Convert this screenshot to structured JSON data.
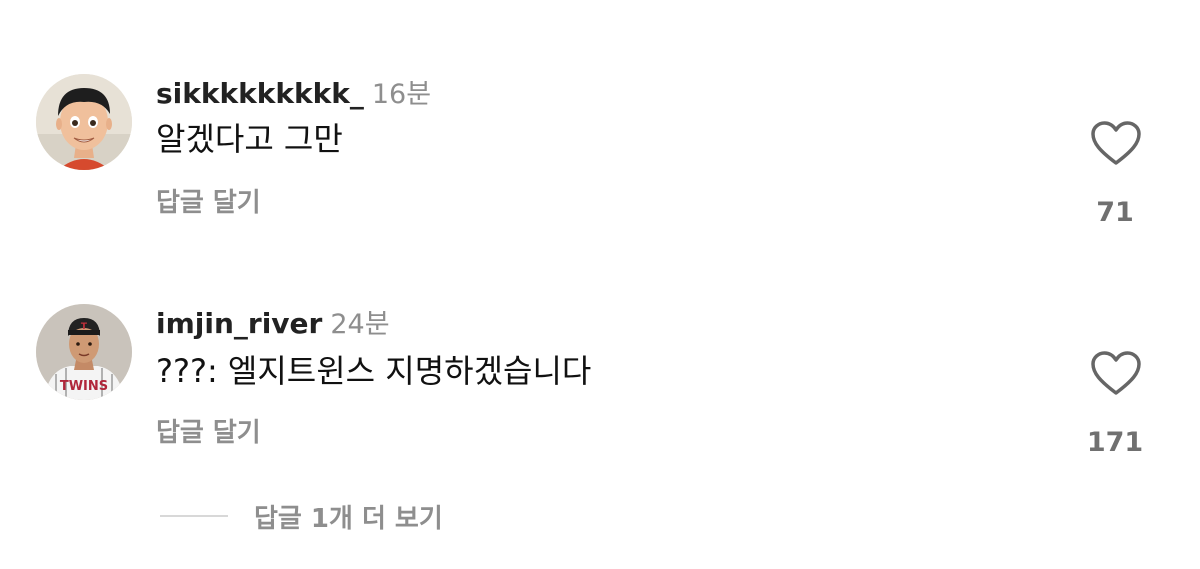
{
  "comments": [
    {
      "username": "sikkkkkkkkk_",
      "time": "16분",
      "text": "알겠다고 그만",
      "reply_label": "답글 달기",
      "likes": "71",
      "avatar_icon": "cartoon-boy-avatar"
    },
    {
      "username": "imjin_river",
      "time": "24분",
      "text": "???: 엘지트윈스 지명하겠습니다",
      "reply_label": "답글 달기",
      "likes": "171",
      "avatar_icon": "baseball-player-avatar"
    }
  ],
  "view_replies_label": "답글 1개 더 보기",
  "icons": {
    "like": "heart-outline-icon"
  },
  "colors": {
    "text": "#111111",
    "muted": "#8e8e8e",
    "like_count": "#707070",
    "divider": "#d8d8d8"
  }
}
